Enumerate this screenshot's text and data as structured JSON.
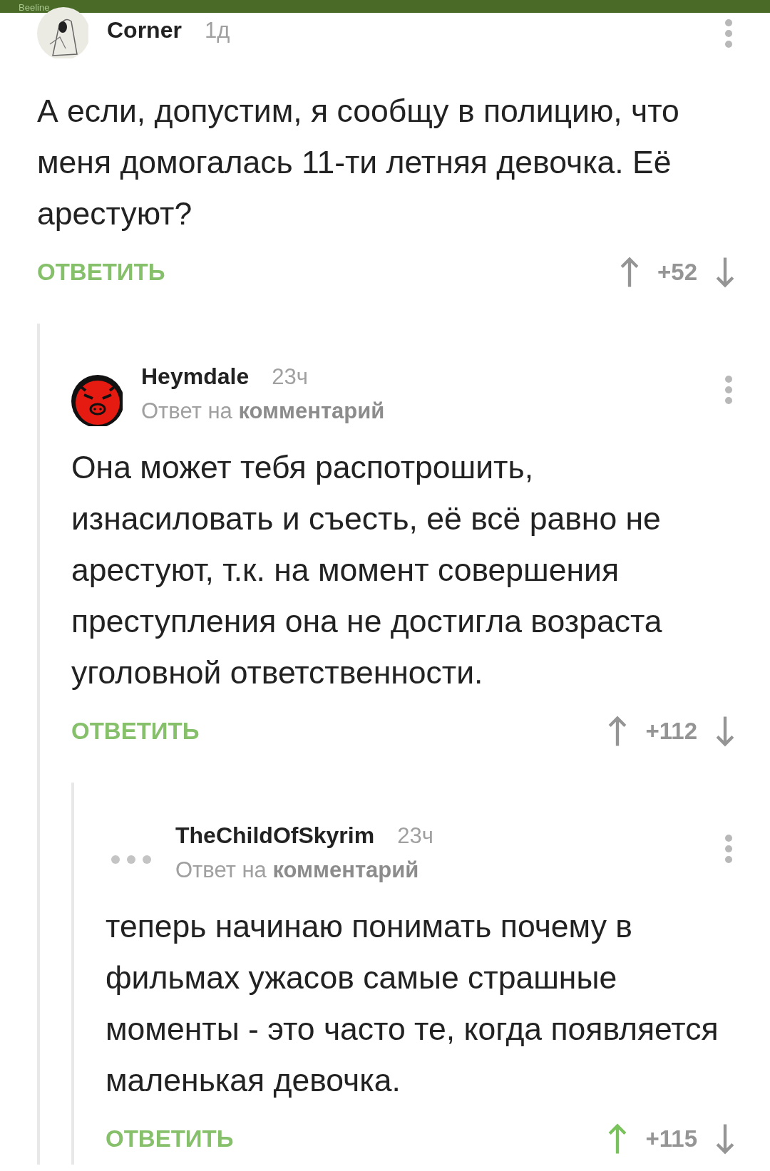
{
  "status_bar": {
    "carrier": "Beeline"
  },
  "comments": [
    {
      "author": "Corner",
      "time": "1д",
      "avatar": {
        "kind": "sketch"
      },
      "text": "А если, допустим, я сообщу в полицию, что меня домогалась 11-ти летняя девочка. Её арестуют?",
      "reply_label": "ОТВЕТИТЬ",
      "score": "+52",
      "upvoted": false,
      "children": [
        {
          "author": "Heymdale",
          "time": "23ч",
          "avatar": {
            "kind": "pig"
          },
          "reply_to": "Ответ на **комментарий**",
          "text": "Она может тебя распотрошить, изнасиловать и съесть, её всё равно не арестуют, т.к. на момент совершения преступления она не достигла возраста уголовной ответственности.",
          "reply_label": "ОТВЕТИТЬ",
          "score": "+112",
          "upvoted": false,
          "children": [
            {
              "author": "TheChildOfSkyrim",
              "time": "23ч",
              "avatar": {
                "kind": "placeholder"
              },
              "reply_to": "Ответ на **комментарий**",
              "text": "теперь начинаю понимать почему в фильмах ужасов самые страшные моменты - это часто те, когда появляется маленькая девочка.",
              "reply_label": "ОТВЕТИТЬ",
              "score": "+115",
              "upvoted": true
            }
          ]
        }
      ]
    }
  ]
}
